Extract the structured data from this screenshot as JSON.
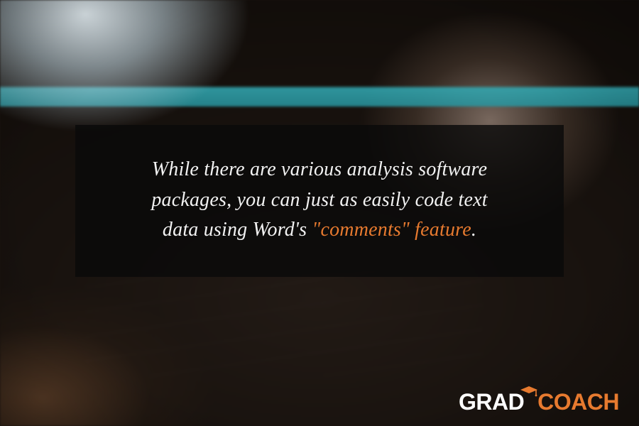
{
  "quote": {
    "line1": "While there are various analysis software",
    "line2": "packages, you can just as easily code text",
    "line3_prefix": "data using Word's ",
    "line3_highlight": "\"comments\" feature",
    "line3_suffix": "."
  },
  "brand": {
    "word1": "GRAD",
    "word2": "COACH",
    "accent_color": "#e77a2f"
  }
}
